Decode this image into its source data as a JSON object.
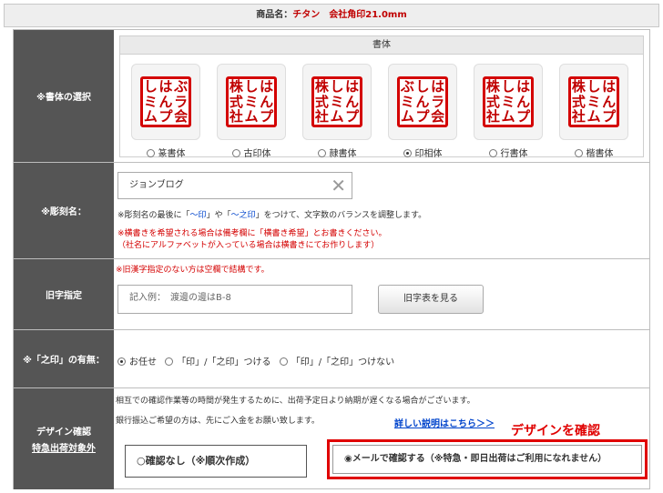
{
  "product": {
    "prefix": "商品名：",
    "name": "チタン　会社角印21.0mm"
  },
  "fonts": {
    "label": "※書体の選択",
    "header": "書体",
    "items": [
      {
        "name": "篆書体",
        "chars": [
          "し",
          "は",
          "ぶ",
          "ミ",
          "ん",
          "ラ",
          "ム",
          "プ",
          "会"
        ],
        "selected": false
      },
      {
        "name": "古印体",
        "chars": [
          "株",
          "し",
          "は",
          "式",
          "ミ",
          "ん",
          "社",
          "ム",
          "プ"
        ],
        "selected": false
      },
      {
        "name": "隷書体",
        "chars": [
          "株",
          "し",
          "は",
          "式",
          "ミ",
          "ん",
          "社",
          "ム",
          "プ"
        ],
        "selected": false
      },
      {
        "name": "印相体",
        "chars": [
          "ぶ",
          "し",
          "は",
          "ミ",
          "ん",
          "ラ",
          "ム",
          "プ",
          "会"
        ],
        "selected": true
      },
      {
        "name": "行書体",
        "chars": [
          "株",
          "し",
          "は",
          "式",
          "ミ",
          "ん",
          "社",
          "ム",
          "プ"
        ],
        "selected": false
      },
      {
        "name": "楷書体",
        "chars": [
          "株",
          "し",
          "は",
          "式",
          "ミ",
          "ん",
          "社",
          "ム",
          "プ"
        ],
        "selected": false
      }
    ]
  },
  "engraving": {
    "label": "※彫刻名：",
    "value": "ジョンブログ",
    "note1_a": "※彫刻名の最後に「",
    "note1_b": "～印",
    "note1_c": "」や「",
    "note1_d": "～之印",
    "note1_e": "」をつけて、文字数のバランスを調整します。",
    "note2": "※横書きを希望される場合は備考欄に「横書き希望」とお書きください。",
    "note3": "（社名にアルファベットが入っている場合は横書きにてお作りします）"
  },
  "old_char": {
    "label": "旧字指定",
    "note": "※旧漢字指定のない方は空欄で結構です。",
    "placeholder": "記入例：　渡邊の邊はB-8",
    "button": "旧字表を見る"
  },
  "noshirushi": {
    "label": "※「之印」の有無：",
    "options": [
      "お任せ",
      "「印」/「之印」つける",
      "「印」/「之印」つけない"
    ],
    "selected": 0
  },
  "design": {
    "label": "デザイン確認",
    "sublabel": "特急出荷対象外",
    "note1": "相互での確認作業等の時間が発生するために、出荷予定日より納期が遅くなる場合がございます。",
    "note2": "銀行振込ご希望の方は、先にご入金をお願い致します。",
    "link": "詳しい説明はこちら＞＞",
    "annotation": "デザインを確認",
    "option_none": "○確認なし（※順次作成）",
    "option_mail": "◉メールで確認する（※特急・即日出荷はご利用になれません）"
  },
  "colors": {
    "accent": "#d40000",
    "header_bg": "#555555",
    "link": "#0044cc"
  }
}
